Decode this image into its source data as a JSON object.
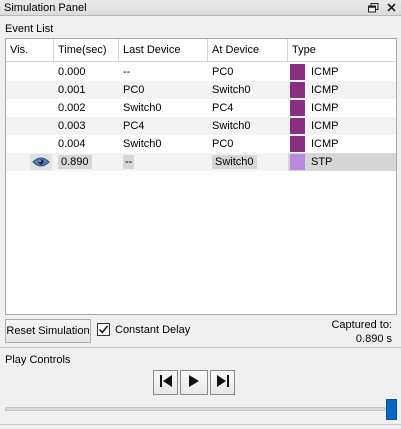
{
  "window": {
    "title": "Simulation Panel"
  },
  "event_list": {
    "label": "Event List",
    "columns": [
      "Vis.",
      "Time(sec)",
      "Last Device",
      "At Device",
      "Type"
    ],
    "rows": [
      {
        "time": "0.000",
        "last": "--",
        "at": "PC0",
        "type": "ICMP",
        "color": "#8a2e82",
        "selected": false
      },
      {
        "time": "0.001",
        "last": "PC0",
        "at": "Switch0",
        "type": "ICMP",
        "color": "#8a2e82",
        "selected": false
      },
      {
        "time": "0.002",
        "last": "Switch0",
        "at": "PC4",
        "type": "ICMP",
        "color": "#8a2e82",
        "selected": false
      },
      {
        "time": "0.003",
        "last": "PC4",
        "at": "Switch0",
        "type": "ICMP",
        "color": "#8a2e82",
        "selected": false
      },
      {
        "time": "0.004",
        "last": "Switch0",
        "at": "PC0",
        "type": "ICMP",
        "color": "#8a2e82",
        "selected": false
      },
      {
        "time": "0.890",
        "last": "--",
        "at": "Switch0",
        "type": "STP",
        "color": "#b98ade",
        "selected": true,
        "vis_icon": "eye-icon"
      }
    ]
  },
  "controls": {
    "reset_label": "Reset Simulation",
    "constant_delay_label": "Constant Delay",
    "constant_delay_checked": true,
    "captured_label": "Captured to:",
    "captured_value": "0.890 s"
  },
  "play_controls": {
    "label": "Play Controls",
    "back_icon": "step-back-icon",
    "play_icon": "play-icon",
    "forward_icon": "step-forward-icon",
    "slider_position": 1.0
  }
}
